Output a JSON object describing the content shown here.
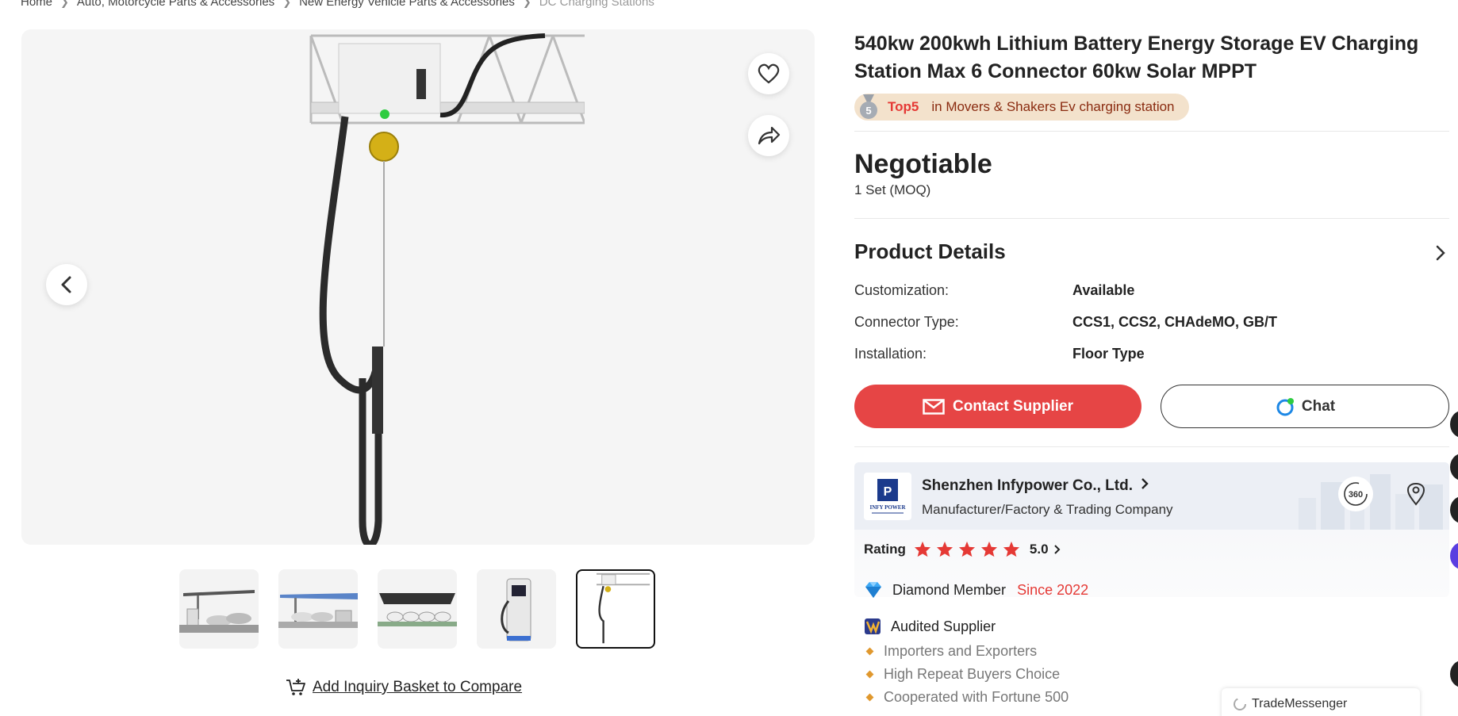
{
  "breadcrumb": {
    "items": [
      "Home",
      "Auto, Motorcycle Parts & Accessories",
      "New Energy Vehicle Parts & Accessories",
      "DC Charging Stations"
    ]
  },
  "gallery": {
    "prev_icon": "chevron-left-icon",
    "favorite_icon": "heart-icon",
    "share_icon": "share-icon",
    "thumbnail_count": 5,
    "active_thumbnail": 5
  },
  "inquiry": {
    "label": "Add Inquiry Basket to Compare"
  },
  "product": {
    "title": "540kw 200kwh Lithium Battery Energy Storage EV Charging Station Max 6 Connector 60kw Solar MPPT",
    "rank_badge": {
      "medal_number": "5",
      "top": "Top5",
      "text": "in Movers & Shakers Ev charging station"
    },
    "price": "Negotiable",
    "moq": "1 Set (MOQ)"
  },
  "details": {
    "title": "Product Details",
    "specs": [
      {
        "label": "Customization:",
        "value": "Available"
      },
      {
        "label": "Connector Type:",
        "value": "CCS1, CCS2, CHAdeMO, GB/T"
      },
      {
        "label": "Installation:",
        "value": "Floor Type"
      }
    ]
  },
  "actions": {
    "contact_label": "Contact Supplier",
    "chat_label": "Chat"
  },
  "supplier": {
    "logo_text": "INFY POWER",
    "name": "Shenzhen Infypower Co., Ltd.",
    "type": "Manufacturer/Factory & Trading Company",
    "rating_label": "Rating",
    "rating_value": "5.0",
    "stars": 5,
    "icon_360_label": "360"
  },
  "membership": {
    "member_label": "Diamond Member",
    "since": "Since 2022",
    "audited_label": "Audited Supplier",
    "features": [
      "Importers and Exporters",
      "High Repeat Buyers Choice",
      "Cooperated with Fortune 500"
    ]
  },
  "trademessenger": {
    "label": "TradeMessenger"
  },
  "colors": {
    "accent": "#e64545",
    "badge_bg": "#f3e2cc",
    "star": "#e53935"
  }
}
